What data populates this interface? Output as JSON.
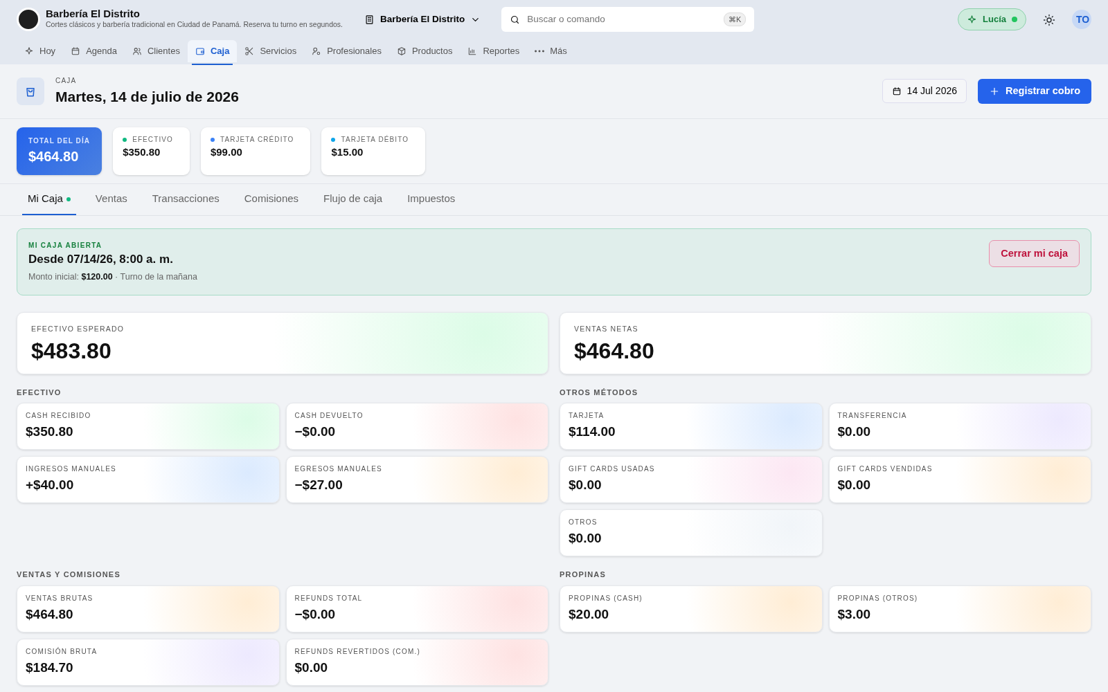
{
  "header": {
    "brand": {
      "name": "Barbería El Distrito",
      "tagline": "Cortes clásicos y barbería tradicional en Ciudad de Panamá. Reserva tu turno en segundos."
    },
    "location": "Barbería El Distrito",
    "search": {
      "placeholder": "Buscar o comando",
      "shortcut": "⌘K"
    },
    "assistant": {
      "label": "Lucía",
      "online": true
    },
    "avatar": "TO"
  },
  "nav": [
    {
      "label": "Hoy",
      "selected": false
    },
    {
      "label": "Agenda",
      "selected": false
    },
    {
      "label": "Clientes",
      "selected": false
    },
    {
      "label": "Caja",
      "selected": true
    },
    {
      "label": "Servicios",
      "selected": false
    },
    {
      "label": "Profesionales",
      "selected": false
    },
    {
      "label": "Productos",
      "selected": false
    },
    {
      "label": "Reportes",
      "selected": false
    },
    {
      "label": "Más",
      "selected": false
    }
  ],
  "page": {
    "eyebrow": "CAJA",
    "title": "Martes, 14 de julio de 2026",
    "date": "14 Jul 2026",
    "action": "Registrar cobro"
  },
  "summary": [
    {
      "kind": "total",
      "label": "TOTAL DEL DÍA",
      "value": "$464.80"
    },
    {
      "kind": "method",
      "label": "EFECTIVO",
      "value": "$350.80",
      "color": "#10b981"
    },
    {
      "kind": "method",
      "label": "TARJETA CRÉDITO",
      "value": "$99.00",
      "color": "#3b82f6"
    },
    {
      "kind": "method",
      "label": "TARJETA DÉBITO",
      "value": "$15.00",
      "color": "#0ea5e9"
    }
  ],
  "tabs": [
    {
      "label": "Mi Caja",
      "selected": true,
      "dot": true
    },
    {
      "label": "Ventas",
      "selected": false,
      "dot": false
    },
    {
      "label": "Transacciones",
      "selected": false,
      "dot": false
    },
    {
      "label": "Comisiones",
      "selected": false,
      "dot": false
    },
    {
      "label": "Flujo de caja",
      "selected": false,
      "dot": false
    },
    {
      "label": "Impuestos",
      "selected": false,
      "dot": false
    }
  ],
  "banner": {
    "eyebrow": "MI CAJA ABIERTA",
    "title": "Desde 07/14/26, 8:00 a. m.",
    "detail": "Monto inicial: **$120.00** · Turno de la mañana",
    "button": "Cerrar mi caja"
  },
  "kpis": [
    {
      "label": "EFECTIVO ESPERADO",
      "value": "$483.80",
      "color": "#dcfce7"
    },
    {
      "label": "VENTAS NETAS",
      "value": "$464.80",
      "color": "#dcfce7"
    }
  ],
  "sections": [
    {
      "title": "EFECTIVO",
      "cards": [
        {
          "label": "CASH RECIBIDO",
          "value": "$350.80",
          "color": "#dcfce7"
        },
        {
          "label": "CASH DEVUELTO",
          "value": "−$0.00",
          "color": "#fee2e2"
        },
        {
          "label": "INGRESOS MANUALES",
          "value": "+$40.00",
          "color": "#dbeafe"
        },
        {
          "label": "EGRESOS MANUALES",
          "value": "−$27.00",
          "color": "#ffedd5"
        }
      ]
    },
    {
      "title": "OTROS MÉTODOS",
      "cards": [
        {
          "label": "TARJETA",
          "value": "$114.00",
          "color": "#dbeafe"
        },
        {
          "label": "TRANSFERENCIA",
          "value": "$0.00",
          "color": "#ede9fe"
        },
        {
          "label": "GIFT CARDS USADAS",
          "value": "$0.00",
          "color": "#fce7f3"
        },
        {
          "label": "GIFT CARDS VENDIDAS",
          "value": "$0.00",
          "color": "#ffedd5"
        },
        {
          "label": "OTROS",
          "value": "$0.00",
          "color": "#f1f5f9"
        }
      ]
    },
    {
      "title": "VENTAS Y COMISIONES",
      "cards": [
        {
          "label": "VENTAS BRUTAS",
          "value": "$464.80",
          "color": "#ffedd5"
        },
        {
          "label": "REFUNDS TOTAL",
          "value": "−$0.00",
          "color": "#fee2e2"
        },
        {
          "label": "COMISIÓN BRUTA",
          "value": "$184.70",
          "color": "#ede9fe"
        },
        {
          "label": "REFUNDS REVERTIDOS (COM.)",
          "value": "$0.00",
          "color": "#fee2e2"
        }
      ]
    },
    {
      "title": "PROPINAS",
      "cards": [
        {
          "label": "PROPINAS (CASH)",
          "value": "$20.00",
          "color": "#ffedd5"
        },
        {
          "label": "PROPINAS (OTROS)",
          "value": "$3.00",
          "color": "#ffedd5"
        }
      ]
    }
  ]
}
